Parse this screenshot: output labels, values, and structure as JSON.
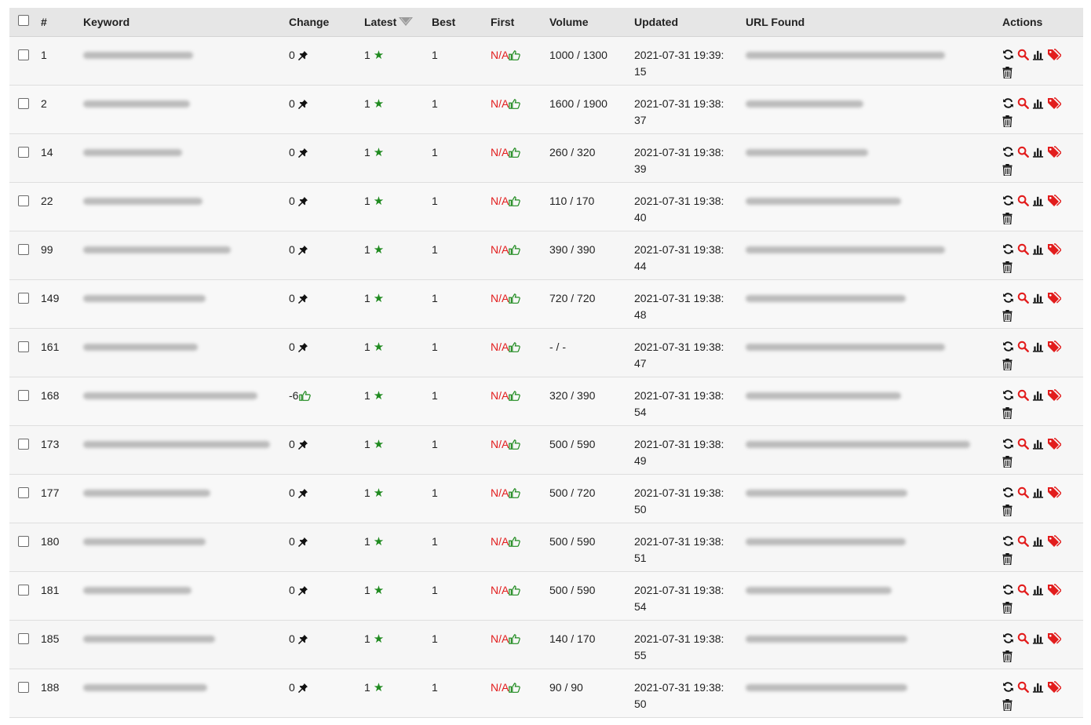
{
  "columns": [
    "#",
    "Keyword",
    "Change",
    "Latest",
    "Best",
    "First",
    "Volume",
    "Updated",
    "URL Found",
    "Actions"
  ],
  "na_label": "N/A",
  "rows": [
    {
      "id": "1",
      "change": "0",
      "latest": "1",
      "best": "1",
      "volume": "1000 / 1300",
      "date": "2021-07-31 19:39:",
      "sec": "15"
    },
    {
      "id": "2",
      "change": "0",
      "latest": "1",
      "best": "1",
      "volume": "1600 / 1900",
      "date": "2021-07-31 19:38:",
      "sec": "37"
    },
    {
      "id": "14",
      "change": "0",
      "latest": "1",
      "best": "1",
      "volume": "260 / 320",
      "date": "2021-07-31 19:38:",
      "sec": "39"
    },
    {
      "id": "22",
      "change": "0",
      "latest": "1",
      "best": "1",
      "volume": "110 / 170",
      "date": "2021-07-31 19:38:",
      "sec": "40"
    },
    {
      "id": "99",
      "change": "0",
      "latest": "1",
      "best": "1",
      "volume": "390 / 390",
      "date": "2021-07-31 19:38:",
      "sec": "44"
    },
    {
      "id": "149",
      "change": "0",
      "latest": "1",
      "best": "1",
      "volume": "720 / 720",
      "date": "2021-07-31 19:38:",
      "sec": "48"
    },
    {
      "id": "161",
      "change": "0",
      "latest": "1",
      "best": "1",
      "volume": "- / -",
      "date": "2021-07-31 19:38:",
      "sec": "47"
    },
    {
      "id": "168",
      "change": "-6",
      "latest": "1",
      "best": "1",
      "volume": "320 / 390",
      "date": "2021-07-31 19:38:",
      "sec": "54",
      "change_icon": "thumbs-up"
    },
    {
      "id": "173",
      "change": "0",
      "latest": "1",
      "best": "1",
      "volume": "500 / 590",
      "date": "2021-07-31 19:38:",
      "sec": "49"
    },
    {
      "id": "177",
      "change": "0",
      "latest": "1",
      "best": "1",
      "volume": "500 / 720",
      "date": "2021-07-31 19:38:",
      "sec": "50"
    },
    {
      "id": "180",
      "change": "0",
      "latest": "1",
      "best": "1",
      "volume": "500 / 590",
      "date": "2021-07-31 19:38:",
      "sec": "51"
    },
    {
      "id": "181",
      "change": "0",
      "latest": "1",
      "best": "1",
      "volume": "500 / 590",
      "date": "2021-07-31 19:38:",
      "sec": "54"
    },
    {
      "id": "185",
      "change": "0",
      "latest": "1",
      "best": "1",
      "volume": "140 / 170",
      "date": "2021-07-31 19:38:",
      "sec": "55"
    },
    {
      "id": "188",
      "change": "0",
      "latest": "1",
      "best": "1",
      "volume": "90 / 90",
      "date": "2021-07-31 19:38:",
      "sec": "50"
    }
  ],
  "icons": {
    "unchanged": "pin-icon",
    "improved": "thumbs-up-icon",
    "latest": "star-icon",
    "sort": "sort-arrow-icon",
    "refresh": "refresh-icon",
    "search": "search-icon",
    "chart": "bar-chart-icon",
    "tag": "tag-icon",
    "delete": "trash-icon"
  },
  "colors": {
    "accent_red": "#e21d1d",
    "accent_green": "#1f8a1f",
    "header_bg": "#e6e6e6",
    "row_bg": "#f6f6f6"
  }
}
